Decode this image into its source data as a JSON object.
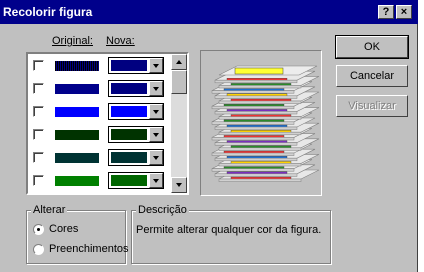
{
  "window": {
    "title": "Recolorir figura",
    "help_label": "?",
    "close_label": "×"
  },
  "headers": {
    "original": "Original:",
    "nova": "Nova:"
  },
  "color_rows": [
    {
      "original_color": "#000080",
      "original_style": "dotted",
      "new_color": "#000080"
    },
    {
      "original_color": "#00008b",
      "original_style": "solid",
      "new_color": "#000080"
    },
    {
      "original_color": "#0000ff",
      "original_style": "solid",
      "new_color": "#0000ff"
    },
    {
      "original_color": "#003300",
      "original_style": "solid",
      "new_color": "#003300"
    },
    {
      "original_color": "#003333",
      "original_style": "solid",
      "new_color": "#003333"
    },
    {
      "original_color": "#008000",
      "original_style": "solid",
      "new_color": "#006600"
    }
  ],
  "buttons": {
    "ok": "OK",
    "cancel": "Cancelar",
    "preview": "Visualizar"
  },
  "alterar": {
    "label": "Alterar",
    "options": [
      "Cores",
      "Preenchimentos"
    ],
    "selected": "Cores"
  },
  "descricao": {
    "label": "Descrição",
    "text": "Permite alterar qualquer cor da figura."
  },
  "preview_icon": "stacked-papers-icon"
}
